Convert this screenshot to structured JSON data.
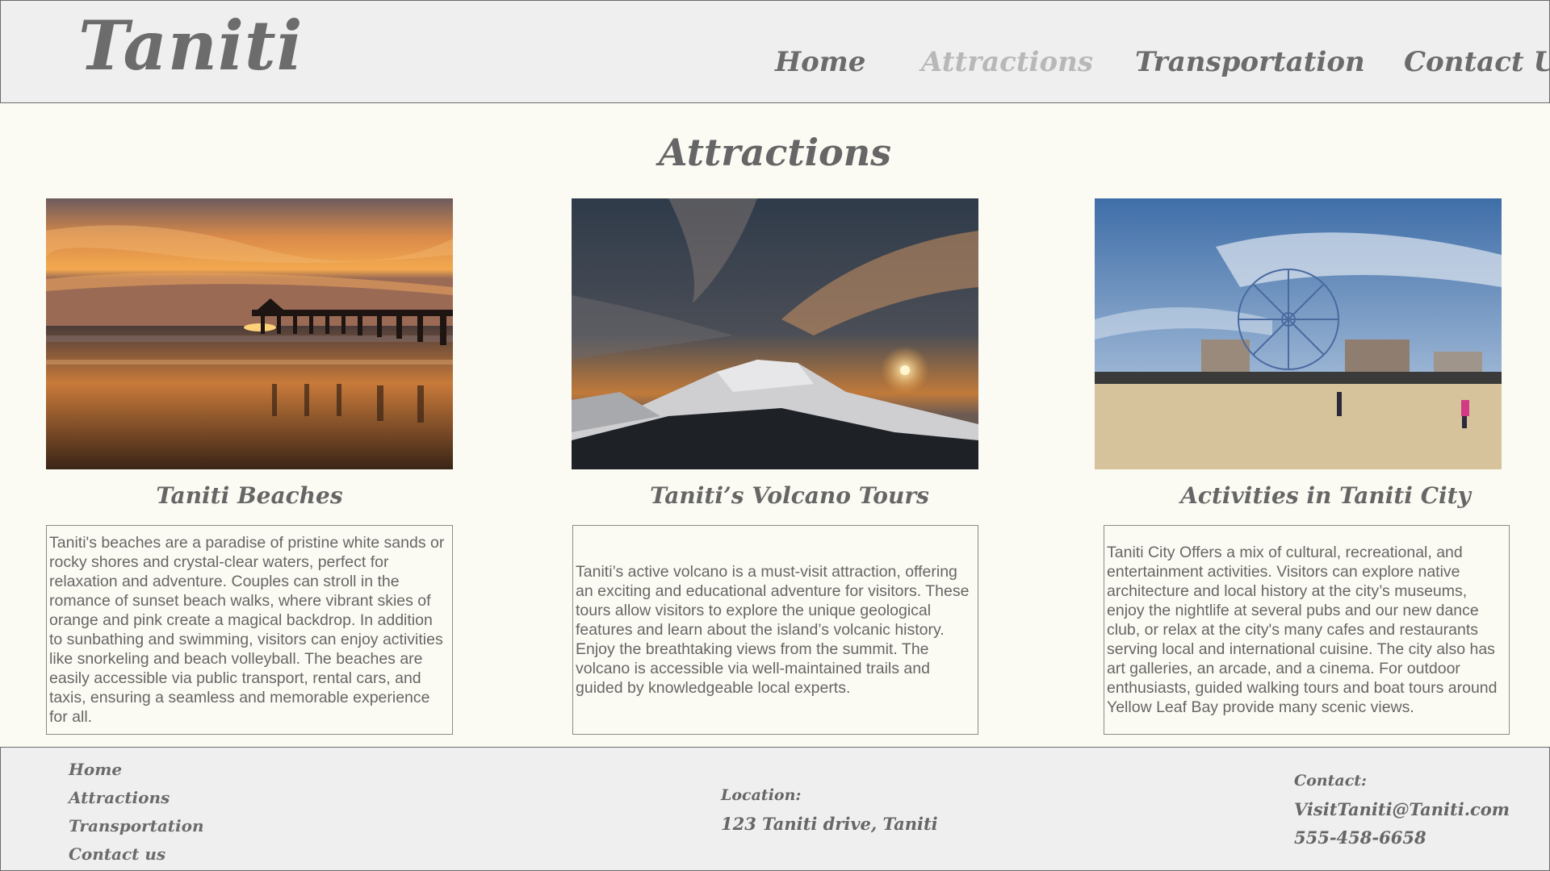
{
  "header": {
    "logo": "Taniti",
    "nav": [
      {
        "label": "Home",
        "active": false
      },
      {
        "label": "Attractions",
        "active": true
      },
      {
        "label": "Transportation",
        "active": false
      },
      {
        "label": "Contact Us",
        "active": false
      }
    ]
  },
  "main": {
    "title": "Attractions",
    "cards": [
      {
        "image": "sunset-beach-pier",
        "title": "Taniti Beaches",
        "text": "Taniti's beaches are a paradise of pristine white sands or rocky shores and crystal-clear waters, perfect for relaxation and adventure. Couples can stroll in the romance of sunset beach walks, where vibrant skies of orange and pink create a magical backdrop. In addition to sunbathing and swimming, visitors can enjoy activities like snorkeling and beach volleyball. The beaches are easily accessible via public transport, rental cars, and taxis, ensuring a seamless and memorable experience for all."
      },
      {
        "image": "volcano-sunset",
        "title": "Taniti’s Volcano Tours",
        "text": "Taniti’s active volcano is a must-visit attraction, offering an exciting and educational adventure for visitors. These tours allow visitors to explore the unique geological features and learn about the island’s volcanic history. Enjoy the breathtaking views from the summit. The volcano is accessible via well-maintained trails and guided by knowledgeable local experts."
      },
      {
        "image": "city-ferris-wheel-beach",
        "title": "Activities in Taniti City",
        "text": "Taniti City Offers a mix of cultural, recreational, and entertainment activities. Visitors can explore native architecture and local history at the city’s museums, enjoy the nightlife at several pubs and our new dance club, or relax at the city's many cafes and restaurants serving local and international cuisine. The city also has art galleries, an arcade, and a cinema. For outdoor enthusiasts, guided walking tours and boat tours around Yellow Leaf Bay provide many scenic views."
      }
    ]
  },
  "footer": {
    "links": [
      "Home",
      "Attractions",
      "Transportation",
      "Contact us"
    ],
    "location_label": "Location:",
    "location_value": "123 Taniti drive, Taniti",
    "contact_label": "Contact:",
    "email": "VisitTaniti@Taniti.com",
    "phone": "555-458-6658"
  }
}
